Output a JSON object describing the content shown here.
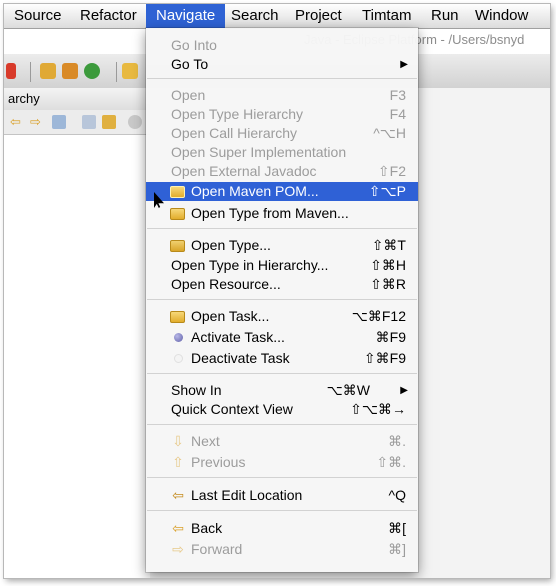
{
  "menubar": {
    "items": [
      {
        "label": "Source"
      },
      {
        "label": "Refactor"
      },
      {
        "label": "Navigate"
      },
      {
        "label": "Search"
      },
      {
        "label": "Project"
      },
      {
        "label": "Timtam"
      },
      {
        "label": "Run"
      },
      {
        "label": "Window"
      }
    ]
  },
  "window": {
    "title": "Java - Eclipse Platform - /Users/bsnyd"
  },
  "view": {
    "tab_label": "archy"
  },
  "menu": {
    "items": [
      {
        "label": "Go Into",
        "shortcut": "",
        "enabled": false
      },
      {
        "label": "Go To",
        "shortcut": "▶",
        "enabled": true
      },
      {
        "label": "Open",
        "shortcut": "F3",
        "enabled": false
      },
      {
        "label": "Open Type Hierarchy",
        "shortcut": "F4",
        "enabled": false
      },
      {
        "label": "Open Call Hierarchy",
        "shortcut": "^⌥H",
        "enabled": false
      },
      {
        "label": "Open Super Implementation",
        "shortcut": "",
        "enabled": false
      },
      {
        "label": "Open External Javadoc",
        "shortcut": "⇧F2",
        "enabled": false
      },
      {
        "label": "Open Maven POM...",
        "shortcut": "⇧⌥P",
        "enabled": true,
        "icon": "folder-icon"
      },
      {
        "label": "Open Type from Maven...",
        "shortcut": "",
        "enabled": true,
        "icon": "folder-icon"
      },
      {
        "label": "Open Type...",
        "shortcut": "⇧⌘T",
        "enabled": true,
        "icon": "open-type-icon"
      },
      {
        "label": "Open Type in Hierarchy...",
        "shortcut": "⇧⌘H",
        "enabled": true
      },
      {
        "label": "Open Resource...",
        "shortcut": "⇧⌘R",
        "enabled": true
      },
      {
        "label": "Open Task...",
        "shortcut": "⌥⌘F12",
        "enabled": true,
        "icon": "folder-icon"
      },
      {
        "label": "Activate Task...",
        "shortcut": "⌘F9",
        "enabled": true,
        "icon": "task-active-icon"
      },
      {
        "label": "Deactivate Task",
        "shortcut": "⇧⌘F9",
        "enabled": true,
        "icon": "task-inactive-icon"
      },
      {
        "label": "Show In",
        "shortcut": "⌥⌘W",
        "enabled": true,
        "submenu": "▶"
      },
      {
        "label": "Quick Context View",
        "shortcut": "⇧⌥⌘→",
        "enabled": true
      },
      {
        "label": "Next",
        "shortcut": "⌘.",
        "enabled": false,
        "icon": "next-arrow-icon"
      },
      {
        "label": "Previous",
        "shortcut": "⇧⌘.",
        "enabled": false,
        "icon": "previous-arrow-icon"
      },
      {
        "label": "Last Edit Location",
        "shortcut": "^Q",
        "enabled": true,
        "icon": "last-edit-icon"
      },
      {
        "label": "Back",
        "shortcut": "⌘[",
        "enabled": true,
        "icon": "back-arrow-icon"
      },
      {
        "label": "Forward",
        "shortcut": "⌘]",
        "enabled": false,
        "icon": "forward-arrow-icon"
      }
    ]
  },
  "colors": {
    "menu_highlight": "#2f61d6",
    "disabled_text": "#9c9c9c",
    "menubar_active": "#2e62d4"
  }
}
